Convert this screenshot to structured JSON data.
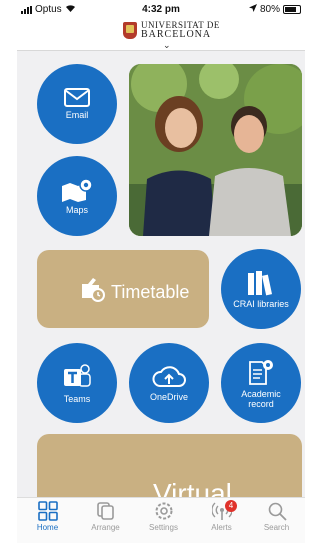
{
  "status_bar": {
    "carrier": "Optus",
    "time": "4:32 pm",
    "battery": "80%"
  },
  "header": {
    "logo_line1": "UNIVERSITAT DE",
    "logo_line2": "BARCELONA"
  },
  "tiles": {
    "email": "Email",
    "maps": "Maps",
    "timetable": "Timetable",
    "crai": "CRAI libraries",
    "teams": "Teams",
    "onedrive": "OneDrive",
    "academic": "Academic record",
    "virtual": "Virtual"
  },
  "tabbar": {
    "home": "Home",
    "arrange": "Arrange",
    "settings": "Settings",
    "alerts": "Alerts",
    "alerts_badge": "4",
    "search": "Search"
  },
  "colors": {
    "accent": "#1a6fc3",
    "tile_gold": "#c9b082"
  }
}
